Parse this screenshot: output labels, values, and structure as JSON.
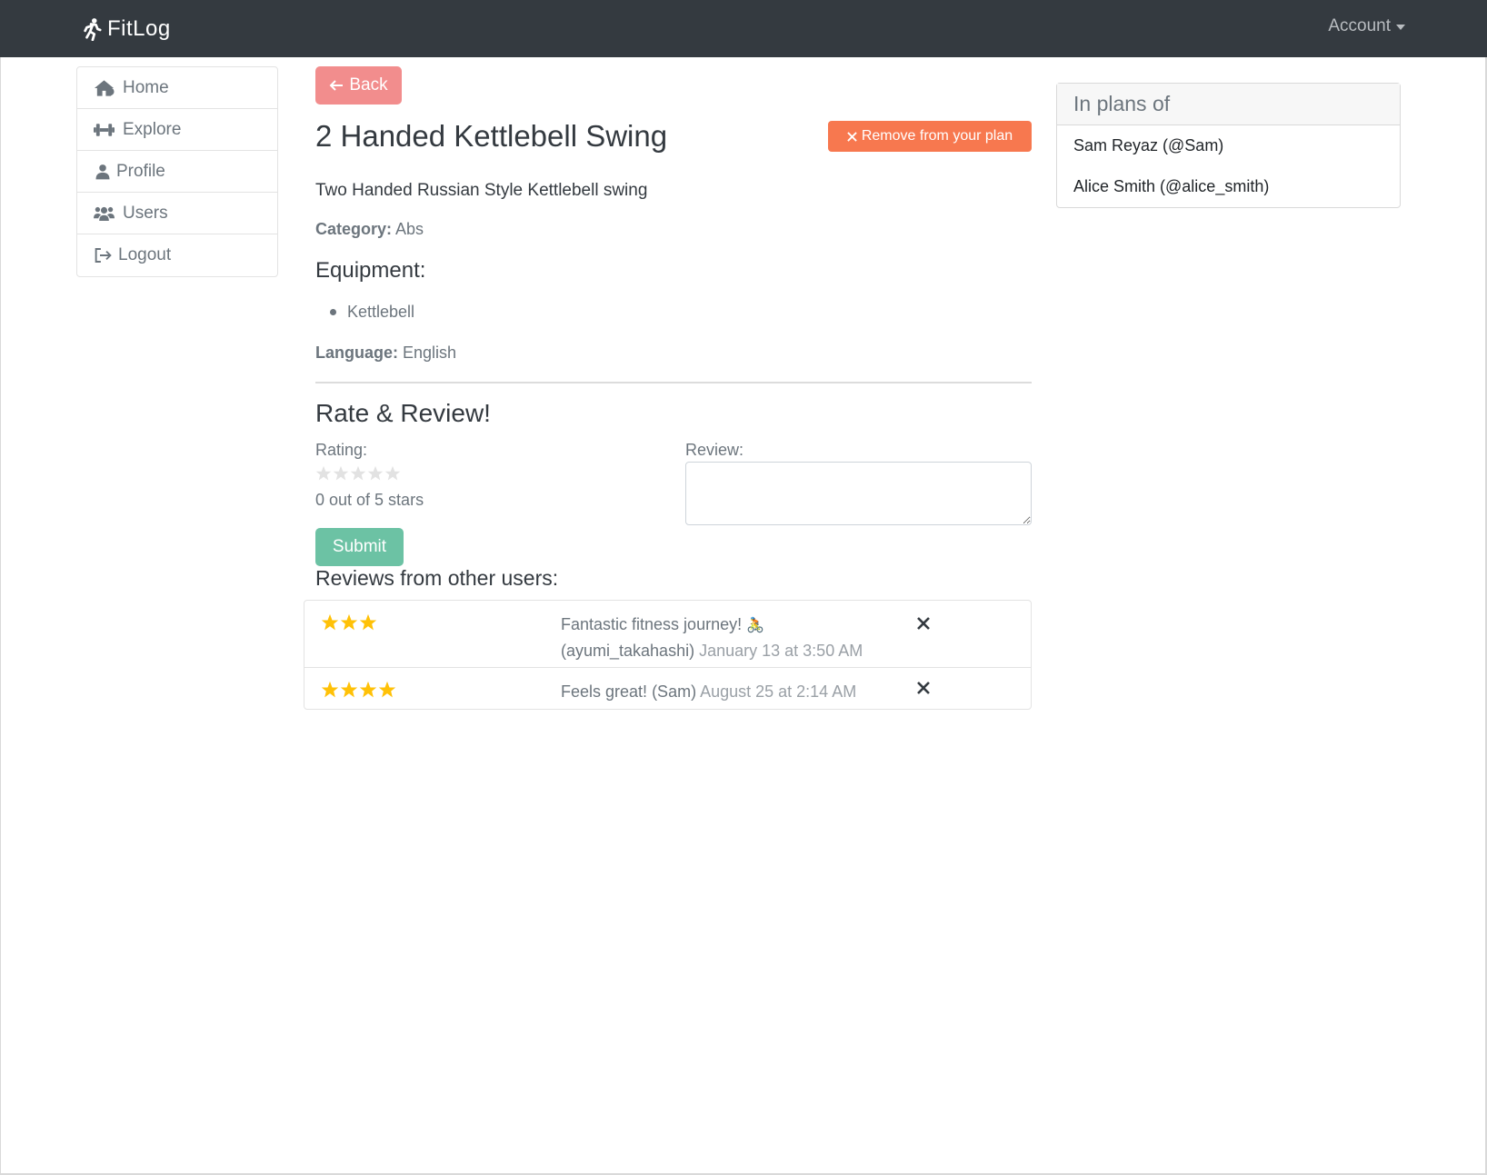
{
  "navbar": {
    "brand": "FitLog",
    "account": "Account"
  },
  "sidebar": {
    "items": [
      {
        "label": "Home",
        "icon": "home-icon"
      },
      {
        "label": "Explore",
        "icon": "dumbbell-icon"
      },
      {
        "label": "Profile",
        "icon": "user-icon"
      },
      {
        "label": "Users",
        "icon": "users-icon"
      },
      {
        "label": "Logout",
        "icon": "logout-icon"
      }
    ]
  },
  "exercise": {
    "back_label": "Back",
    "title": "2 Handed Kettlebell Swing",
    "remove_label": "Remove from your plan",
    "description": "Two Handed Russian Style Kettlebell swing",
    "category_label": "Category:",
    "category": "Abs",
    "equipment_heading": "Equipment:",
    "equipment": [
      "Kettlebell"
    ],
    "language_label": "Language:",
    "language": "English"
  },
  "rate": {
    "heading": "Rate & Review!",
    "rating_label": "Rating:",
    "rating_value": 0,
    "rating_max": 5,
    "stars_text": "0 out of 5 stars",
    "review_label": "Review:",
    "review_value": "",
    "submit_label": "Submit"
  },
  "reviews": {
    "heading": "Reviews from other users:",
    "items": [
      {
        "stars": 3,
        "text": "Fantastic fitness journey!",
        "emoji": "🚴",
        "user": "(ayumi_takahashi)",
        "when": "January 13 at 3:50 AM"
      },
      {
        "stars": 4,
        "text": "Feels great!",
        "emoji": "",
        "user": "(Sam)",
        "when": "August 25 at 2:14 AM"
      }
    ]
  },
  "plans": {
    "heading": "In plans of",
    "users": [
      "Sam Reyaz (@Sam)",
      "Alice Smith (@alice_smith)"
    ]
  },
  "colors": {
    "navbar": "#343a40",
    "back_button": "#f28d8d",
    "remove_button": "#f7784f",
    "submit_button": "#6cc2a4",
    "star": "#ffc107"
  }
}
